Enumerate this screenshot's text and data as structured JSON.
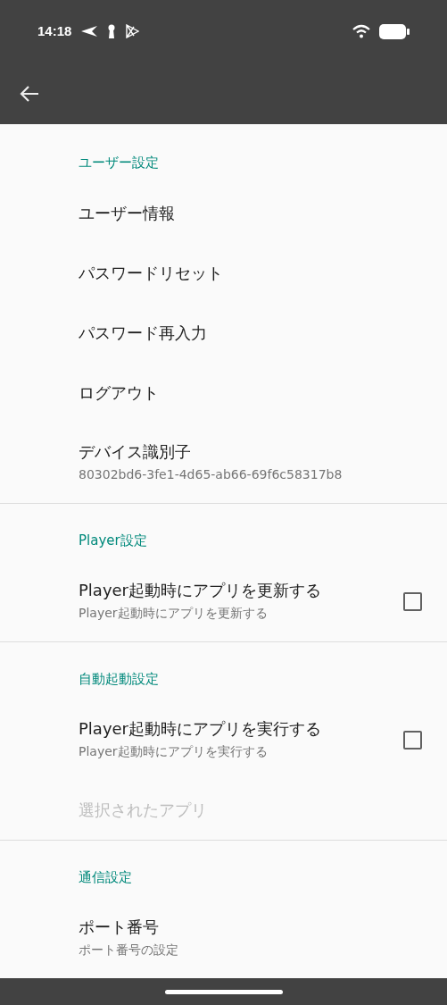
{
  "status_bar": {
    "time": "14:18"
  },
  "sections": [
    {
      "title": "ユーザー設定",
      "items": [
        {
          "kind": "plain",
          "title": "ユーザー情報",
          "disabled": false
        },
        {
          "kind": "plain",
          "title": "パスワードリセット",
          "disabled": false
        },
        {
          "kind": "plain",
          "title": "パスワード再入力",
          "disabled": false
        },
        {
          "kind": "plain",
          "title": "ログアウト",
          "disabled": false
        },
        {
          "kind": "plain",
          "title": "デバイス識別子",
          "summary": "80302bd6-3fe1-4d65-ab66-69f6c58317b8",
          "disabled": false
        }
      ]
    },
    {
      "title": "Player設定",
      "items": [
        {
          "kind": "checkbox",
          "title": "Player起動時にアプリを更新する",
          "summary": "Player起動時にアプリを更新する",
          "checked": false,
          "disabled": false
        }
      ]
    },
    {
      "title": "自動起動設定",
      "items": [
        {
          "kind": "checkbox",
          "title": "Player起動時にアプリを実行する",
          "summary": "Player起動時にアプリを実行する",
          "checked": false,
          "disabled": false
        },
        {
          "kind": "plain",
          "title": "選択されたアプリ",
          "disabled": true
        }
      ]
    },
    {
      "title": "通信設定",
      "items": [
        {
          "kind": "plain",
          "title": "ポート番号",
          "summary": "ポート番号の設定",
          "disabled": false
        }
      ]
    }
  ]
}
